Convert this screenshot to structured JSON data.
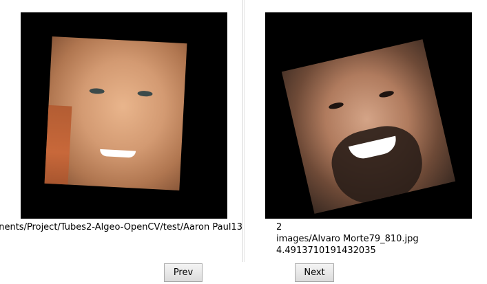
{
  "left_panel": {
    "image_path_tail": "nents/Project/Tubes2-Algeo-OpenCV/test/Aaron Paul13"
  },
  "right_panel": {
    "rank": "2",
    "image_path": "images/Alvaro Morte79_810.jpg",
    "distance": "4.4913710191432035"
  },
  "nav": {
    "prev_label": "Prev",
    "next_label": "Next"
  }
}
